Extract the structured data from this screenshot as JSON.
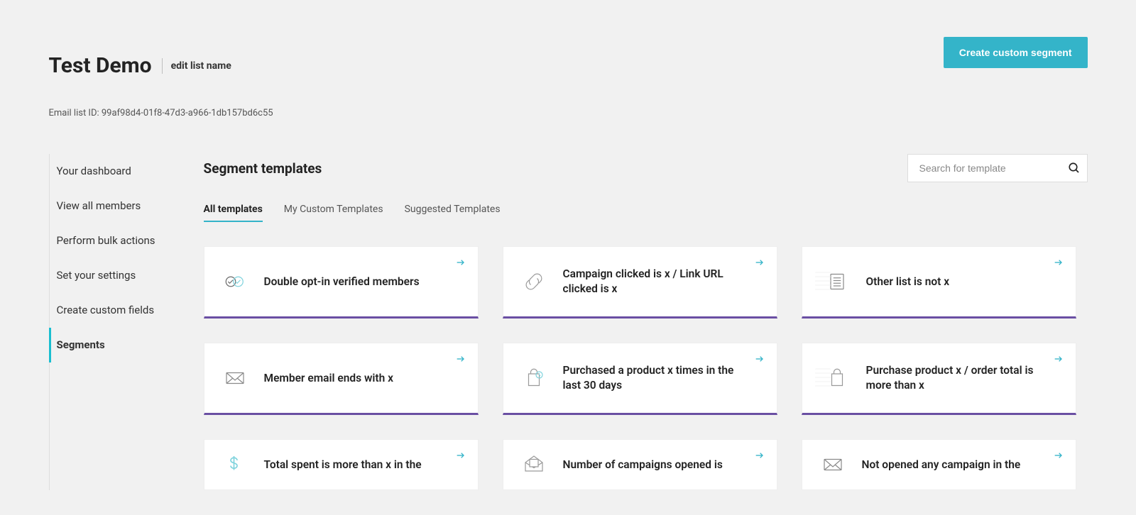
{
  "header": {
    "title": "Test Demo",
    "edit_link": "edit list name",
    "list_id_line": "Email list ID: 99af98d4-01f8-47d3-a966-1db157bd6c55",
    "create_button": "Create custom segment"
  },
  "sidebar": {
    "items": [
      {
        "label": "Your dashboard",
        "active": false
      },
      {
        "label": "View all members",
        "active": false
      },
      {
        "label": "Perform bulk actions",
        "active": false
      },
      {
        "label": "Set your settings",
        "active": false
      },
      {
        "label": "Create custom fields",
        "active": false
      },
      {
        "label": "Segments",
        "active": true
      }
    ]
  },
  "main": {
    "section_title": "Segment templates",
    "search_placeholder": "Search for template",
    "tabs": [
      {
        "label": "All templates",
        "active": true
      },
      {
        "label": "My Custom Templates",
        "active": false
      },
      {
        "label": "Suggested Templates",
        "active": false
      }
    ],
    "cards": [
      {
        "title": "Double opt-in verified members",
        "icon": "double-check"
      },
      {
        "title": "Campaign clicked is x / Link URL clicked is x",
        "icon": "link"
      },
      {
        "title": "Other list is not x",
        "icon": "list"
      },
      {
        "title": "Member email ends with x",
        "icon": "envelope"
      },
      {
        "title": "Purchased a product x times in the last 30 days",
        "icon": "bag-clock"
      },
      {
        "title": "Purchase product x / order total is more than x",
        "icon": "bag"
      },
      {
        "title": "Total spent is more than x in the",
        "icon": "dollar"
      },
      {
        "title": "Number of campaigns opened is",
        "icon": "open-envelope"
      },
      {
        "title": "Not opened any campaign in the",
        "icon": "envelope"
      }
    ]
  }
}
